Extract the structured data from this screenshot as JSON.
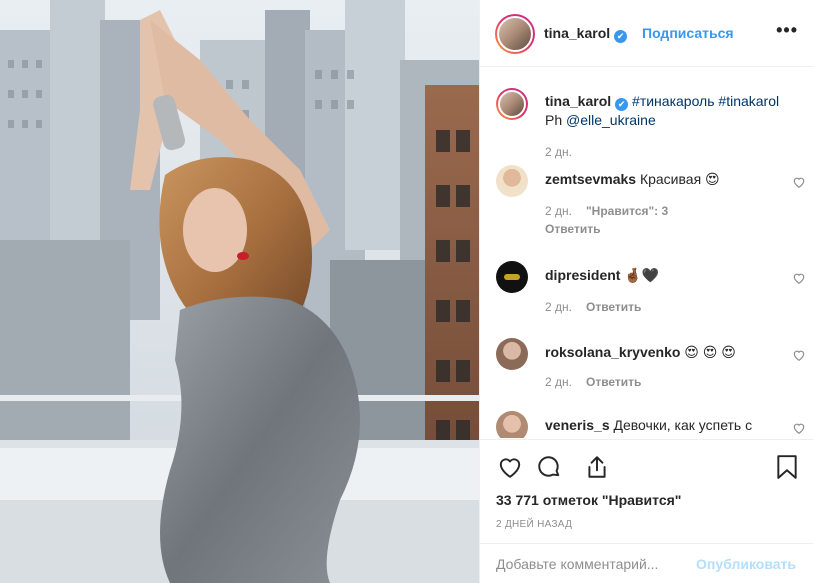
{
  "header": {
    "username": "tina_karol",
    "verified_mark": "✔",
    "follow_label": "Подписаться",
    "more_label": "•••"
  },
  "caption": {
    "username": "tina_karol",
    "text_tags": "#тинакароль #tinakarol",
    "line2_prefix": "Ph ",
    "mention": "@elle_ukraine",
    "time": "2 дн."
  },
  "comments": [
    {
      "username": "zemtsevmaks",
      "text": "Красивая 😍",
      "time": "2 дн.",
      "likes": "\"Нравится\": 3",
      "reply": "Ответить"
    },
    {
      "username": "dipresident",
      "text": "🤞🏾🖤",
      "time": "2 дн.",
      "reply": "Ответить"
    },
    {
      "username": "roksolana_kryvenko",
      "text": "😍 😍 😍",
      "time": "2 дн.",
      "reply": "Ответить"
    },
    {
      "username": "veneris_s",
      "text": "Девочки, как успеть с"
    }
  ],
  "post": {
    "likes_text": "33 771 отметок \"Нравится\"",
    "date_text": "2 ДНЕЙ НАЗАД"
  },
  "add_comment": {
    "placeholder": "Добавьте комментарий...",
    "publish_label": "Опубликовать"
  },
  "icons": [
    "heart-icon",
    "comment-icon",
    "share-icon",
    "bookmark-icon",
    "verified-icon",
    "more-icon"
  ],
  "colors": {
    "accent": "#3897f0",
    "publish_disabled": "#b2dffc",
    "muted": "#8e8e8e",
    "text": "#262626"
  }
}
